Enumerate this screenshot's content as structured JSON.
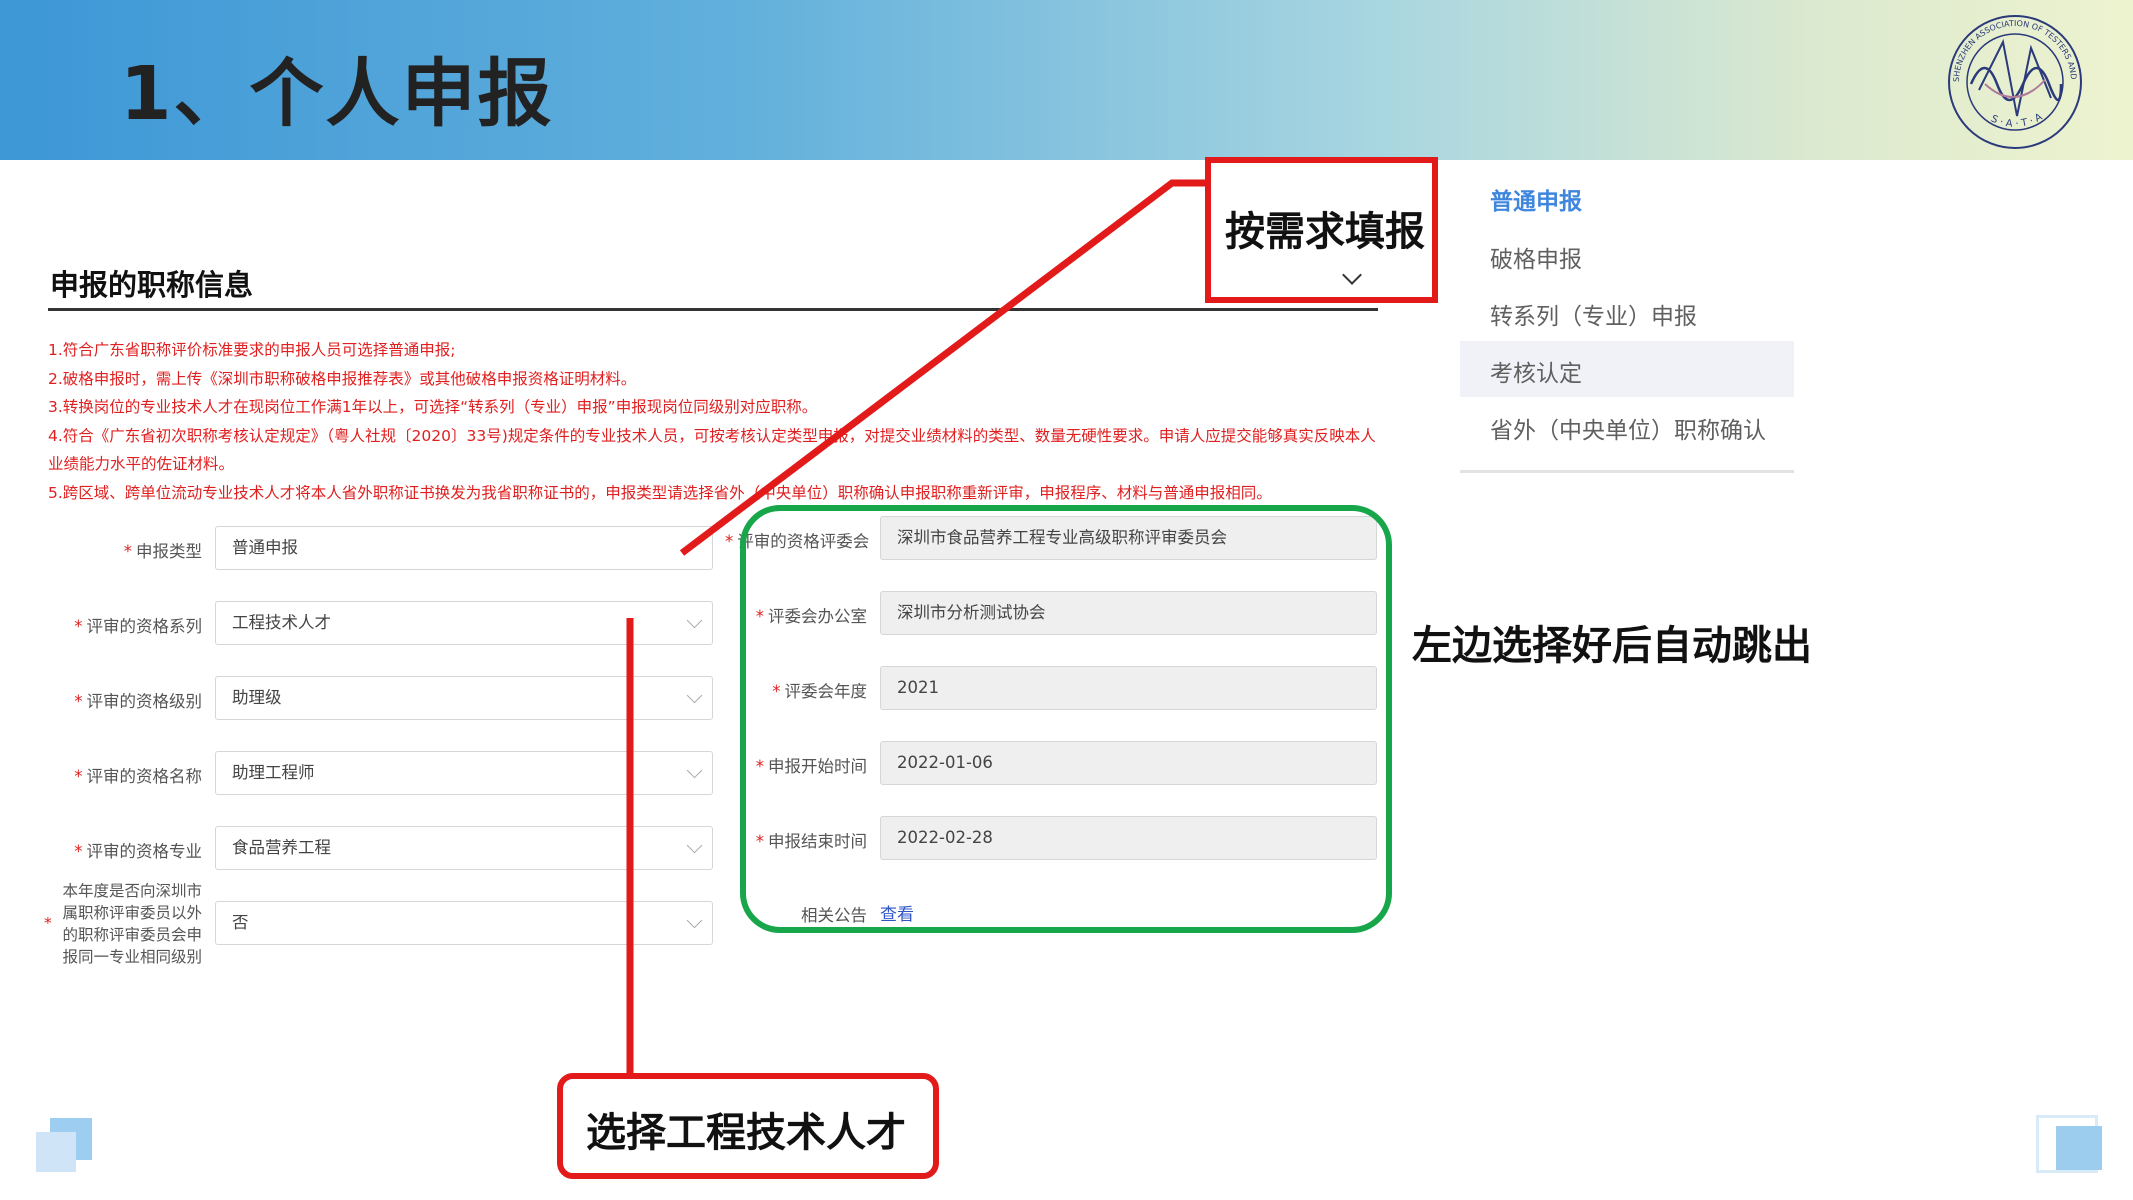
{
  "slide": {
    "title": "1、个人申报",
    "logo": {
      "top_text": "SHENZHEN ASSOCIATION OF TESTERS AND ANALYSIS",
      "bottom_text": "S · A · T · A"
    }
  },
  "form": {
    "section_title": "申报的职称信息",
    "notes": [
      "1.符合广东省职称评价标准要求的申报人员可选择普通申报;",
      "2.破格申报时，需上传《深圳市职称破格申报推荐表》或其他破格申报资格证明材料。",
      "3.转换岗位的专业技术人才在现岗位工作满1年以上，可选择“转系列（专业）申报”申报现岗位同级别对应职称。",
      "4.符合《广东省初次职称考核认定规定》（粤人社规〔2020〕33号)规定条件的专业技术人员，可按考核认定类型申报，对提交业绩材料的类型、数量无硬性要求。申请人应提交能够真实反映本人",
      "业绩能力水平的佐证材料。",
      "5.跨区域、跨单位流动专业技术人才将本人省外职称证书换发为我省职称证书的，申报类型请选择省外（中央单位）职称确认申报职称重新评审，申报程序、材料与普通申报相同。"
    ],
    "left_fields": [
      {
        "label": "申报类型",
        "value": "普通申报"
      },
      {
        "label": "评审的资格系列",
        "value": "工程技术人才"
      },
      {
        "label": "评审的资格级别",
        "value": "助理级"
      },
      {
        "label": "评审的资格名称",
        "value": "助理工程师"
      },
      {
        "label": "评审的资格专业",
        "value": "食品营养工程"
      }
    ],
    "extra_question": {
      "label": "本年度是否向深圳市属职称评审委员以外的职称评审委员会申报同一专业相同级别",
      "value": "否"
    },
    "right_fields": [
      {
        "label": "评审的资格评委会",
        "value": "深圳市食品营养工程专业高级职称评审委员会"
      },
      {
        "label": "评委会办公室",
        "value": "深圳市分析测试协会"
      },
      {
        "label": "评委会年度",
        "value": "2021"
      },
      {
        "label": "申报开始时间",
        "value": "2022-01-06"
      },
      {
        "label": "申报结束时间",
        "value": "2022-02-28"
      }
    ],
    "announcement": {
      "label": "相关公告",
      "link": "查看"
    }
  },
  "dropdown_menu": {
    "items": [
      "普通申报",
      "破格申报",
      "转系列（专业）申报",
      "考核认定",
      "省外（中央单位）职称确认"
    ]
  },
  "callouts": {
    "fill_on_demand": "按需求填报",
    "auto_fill": "左边选择好后自动跳出",
    "select_engineering": "选择工程技术人才"
  },
  "colors": {
    "annotation_red": "#e21a1a",
    "annotation_green": "#17a64a",
    "menu_active": "#3f86dd",
    "note_red": "#e02020"
  }
}
